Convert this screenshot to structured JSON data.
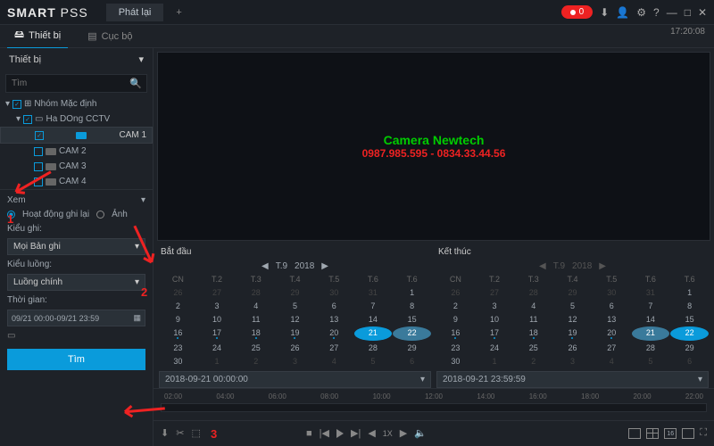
{
  "app": {
    "name_a": "SMART",
    "name_b": "PSS"
  },
  "toptabs": {
    "playback": "Phát lại"
  },
  "rec": {
    "count": "0"
  },
  "clock": "17:20:08",
  "tabs2": {
    "device": "Thiết bị",
    "local": "Cục bộ"
  },
  "side": {
    "header": "Thiết bị",
    "search_ph": "Tìm",
    "group": "Nhóm Mặc định",
    "nvr": "Ha DOng CCTV",
    "cams": [
      "CAM 1",
      "CAM 2",
      "CAM 3",
      "CAM 4"
    ]
  },
  "lower": {
    "view": "Xem",
    "record": "Hoạt động ghi lại",
    "image": "Ảnh",
    "rectype_lbl": "Kiểu ghi:",
    "rectype_val": "Mọi Bản ghi",
    "stream_lbl": "Kiểu luồng:",
    "stream_val": "Luồng chính",
    "time_lbl": "Thời gian:",
    "time_val": "09/21 00:00-09/21 23:59",
    "search": "Tìm"
  },
  "wm": {
    "l1": "Camera Newtech",
    "l2": "0987.985.595 - 0834.33.44.56"
  },
  "cal": {
    "start": "Bắt đầu",
    "end": "Kết thúc",
    "month": "T.9",
    "year": "2018",
    "dow": [
      "CN",
      "T.2",
      "T.3",
      "T.4",
      "T.5",
      "T.6",
      "T.6"
    ],
    "start_dt": "2018-09-21 00:00:00",
    "end_dt": "2018-09-21 23:59:59"
  },
  "tl": {
    "ticks": [
      "02:00",
      "04:00",
      "06:00",
      "08:00",
      "10:00",
      "12:00",
      "14:00",
      "16:00",
      "18:00",
      "20:00",
      "22:00"
    ]
  },
  "ctrl": {
    "speed": "1X",
    "grid": "16"
  },
  "ann": {
    "n1": "1",
    "n2": "2",
    "n3": "3"
  }
}
